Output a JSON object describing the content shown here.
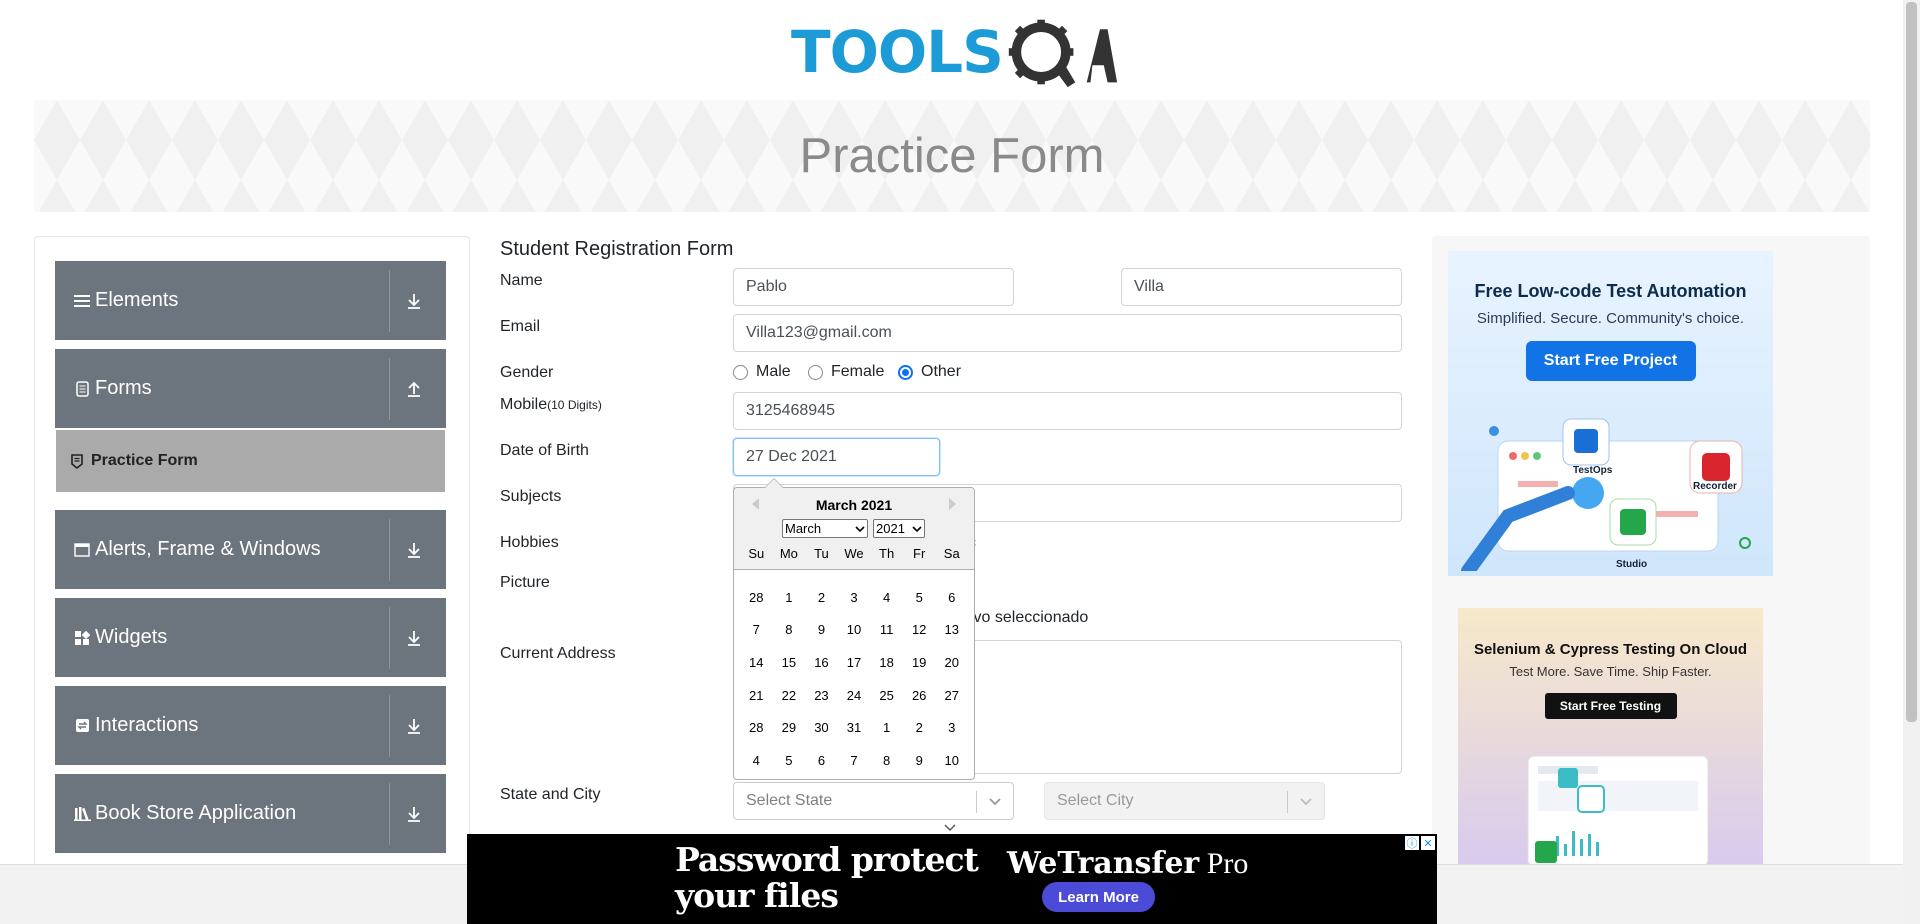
{
  "brand": {
    "logo_text_1": "TOOLS",
    "logo_text_2": "QA"
  },
  "banner": {
    "title": "Practice Form"
  },
  "sidebar": {
    "groups": [
      {
        "label": "Elements",
        "icon": "list-icon",
        "expanded": false
      },
      {
        "label": "Forms",
        "icon": "document-icon",
        "expanded": true
      },
      {
        "label": "Alerts, Frame & Windows",
        "icon": "window-icon",
        "expanded": false
      },
      {
        "label": "Widgets",
        "icon": "grid-icon",
        "expanded": false
      },
      {
        "label": "Interactions",
        "icon": "interaction-icon",
        "expanded": false
      },
      {
        "label": "Book Store Application",
        "icon": "books-icon",
        "expanded": false
      }
    ],
    "active_item": {
      "label": "Practice Form",
      "icon": "form-icon"
    }
  },
  "form": {
    "title": "Student Registration Form",
    "name_label": "Name",
    "first_name": "Pablo",
    "last_name": "Villa",
    "email_label": "Email",
    "email": "Villa123@gmail.com",
    "gender_label": "Gender",
    "genders": [
      {
        "label": "Male",
        "checked": false
      },
      {
        "label": "Female",
        "checked": false
      },
      {
        "label": "Other",
        "checked": true
      }
    ],
    "mobile_label": "Mobile",
    "mobile_hint": "(10 Digits)",
    "mobile": "3125468945",
    "dob_label": "Date of Birth",
    "dob": "27 Dec 2021",
    "subjects_label": "Subjects",
    "hobbies_label": "Hobbies",
    "hobbies_partial": "c",
    "picture_label": "Picture",
    "picture_status_partial": "ivo seleccionado",
    "address_label": "Current Address",
    "state_city_label": "State and City",
    "state_placeholder": "Select State",
    "city_placeholder": "Select City"
  },
  "datepicker": {
    "month_year": "March 2021",
    "month_select": "March",
    "year_select": "2021",
    "weekdays": [
      "Su",
      "Mo",
      "Tu",
      "We",
      "Th",
      "Fr",
      "Sa"
    ],
    "weeks": [
      [
        "28",
        "1",
        "2",
        "3",
        "4",
        "5",
        "6"
      ],
      [
        "7",
        "8",
        "9",
        "10",
        "11",
        "12",
        "13"
      ],
      [
        "14",
        "15",
        "16",
        "17",
        "18",
        "19",
        "20"
      ],
      [
        "21",
        "22",
        "23",
        "24",
        "25",
        "26",
        "27"
      ],
      [
        "28",
        "29",
        "30",
        "31",
        "1",
        "2",
        "3"
      ],
      [
        "4",
        "5",
        "6",
        "7",
        "8",
        "9",
        "10"
      ]
    ]
  },
  "ads": {
    "ad1": {
      "headline": "Free Low-code Test Automation",
      "subline": "Simplified. Secure. Community's choice.",
      "cta": "Start Free Project",
      "labels": [
        "TestOps",
        "Recorder",
        "Studio"
      ]
    },
    "ad2": {
      "headline": "Selenium & Cypress Testing On Cloud",
      "subline": "Test More. Save Time. Ship Faster.",
      "cta": "Start Free Testing"
    },
    "bottom": {
      "line1": "Password protect",
      "line2": "your files",
      "brand_bold": "WeTransfer",
      "brand_light": " Pro",
      "cta": "Learn More"
    }
  },
  "colors": {
    "sidebar_group": "#6c757d",
    "active_item": "#aaaaaa",
    "accent": "#0d6efd",
    "logo_blue": "#1c9bd6"
  }
}
